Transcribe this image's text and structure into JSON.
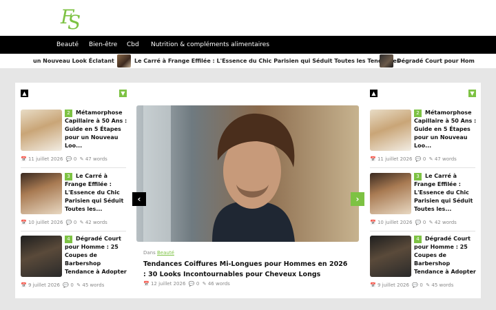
{
  "logo": {
    "letter1": "F",
    "letter2": "S",
    "color": "#7dc243"
  },
  "nav": {
    "items": [
      {
        "label": "Beauté"
      },
      {
        "label": "Bien-être"
      },
      {
        "label": "Cbd"
      },
      {
        "label": "Nutrition & compléments alimentaires"
      }
    ]
  },
  "ticker": {
    "items": [
      {
        "label": "un Nouveau Look Éclatant"
      },
      {
        "label": "Le Carré à Frange Effilée : L'Essence du Chic Parisien qui Séduit Toutes les Tendances"
      },
      {
        "label": "Dégradé Court pour Hom"
      }
    ]
  },
  "sidebar_left": {
    "up_icon": "chevron-up-icon",
    "down_icon": "chevron-down-icon",
    "cards": [
      {
        "number": "2",
        "title": "Métamorphose Capillaire à 50 Ans : Guide en 5 Étapes pour un Nouveau Loo...",
        "date": "11 juillet 2026",
        "comments": "0",
        "words": "47 words"
      },
      {
        "number": "3",
        "title": "Le Carré à Frange Effilée : L'Essence du Chic Parisien qui Séduit Toutes les...",
        "date": "10 juillet 2026",
        "comments": "0",
        "words": "42 words"
      },
      {
        "number": "4",
        "title": "Dégradé Court pour Homme : 25 Coupes de Barbershop Tendance à Adopter",
        "date": "9 juillet 2026",
        "comments": "0",
        "words": "45 words"
      }
    ]
  },
  "sidebar_right": {
    "cards": [
      {
        "number": "2",
        "title": "Métamorphose Capillaire à 50 Ans : Guide en 5 Étapes pour un Nouveau Loo...",
        "date": "11 juillet 2026",
        "comments": "0",
        "words": "47 words"
      },
      {
        "number": "3",
        "title": "Le Carré à Frange Effilée : L'Essence du Chic Parisien qui Séduit Toutes les...",
        "date": "10 juillet 2026",
        "comments": "0",
        "words": "42 words"
      },
      {
        "number": "4",
        "title": "Dégradé Court pour Homme : 25 Coupes de Barbershop Tendance à Adopter",
        "date": "9 juillet 2026",
        "comments": "0",
        "words": "45 words"
      }
    ]
  },
  "featured": {
    "dans": "Dans",
    "category": "Beauté",
    "title": "Tendances Coiffures Mi-Longues pour Hommes en 2026 : 30 Looks Incontournables pour Cheveux Longs",
    "date": "12 juillet 2026",
    "comments": "0",
    "words": "46 words"
  },
  "icons": {
    "calendar": "📅",
    "comment": "💬",
    "edit": "✎",
    "up": "▲",
    "down": "▼",
    "prev": "‹",
    "next": "›"
  },
  "colors": {
    "accent": "#7dc243",
    "nav_bg": "#000000"
  }
}
